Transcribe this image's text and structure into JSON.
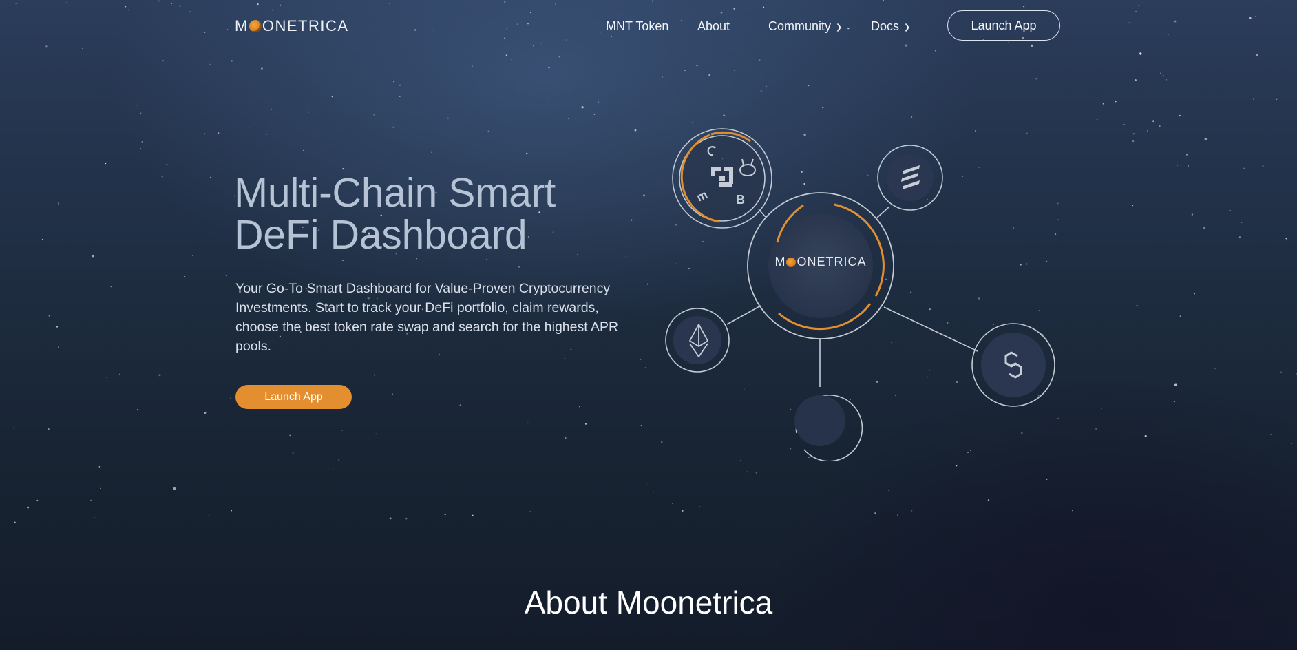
{
  "brand": {
    "name_prefix": "M",
    "name_suffix": "ONETRICA"
  },
  "nav": {
    "items": [
      {
        "label": "MNT Token"
      },
      {
        "label": "About"
      },
      {
        "label": "Community"
      },
      {
        "label": "Docs"
      }
    ],
    "launch_label": "Launch App"
  },
  "hero": {
    "title_line1": "Multi-Chain Smart",
    "title_line2": "DeFi Dashboard",
    "description": "Your Go-To Smart Dashboard for Value-Proven Cryptocurrency Investments. Start to track your DeFi portfolio, claim rewards, choose the best token rate swap and search for the highest APR pools.",
    "launch_label": "Launch App"
  },
  "network": {
    "center_prefix": "M",
    "center_suffix": "ONETRICA",
    "nodes": [
      {
        "icon": "exchange-cluster-icon"
      },
      {
        "icon": "solana-icon"
      },
      {
        "icon": "ethereum-icon"
      },
      {
        "icon": "empty-chain-icon"
      },
      {
        "icon": "polygon-icon"
      }
    ]
  },
  "about": {
    "title": "About Moonetrica"
  },
  "colors": {
    "accent": "#e38f30",
    "title": "#b5c3d5",
    "ring": "#c5ccd6"
  }
}
